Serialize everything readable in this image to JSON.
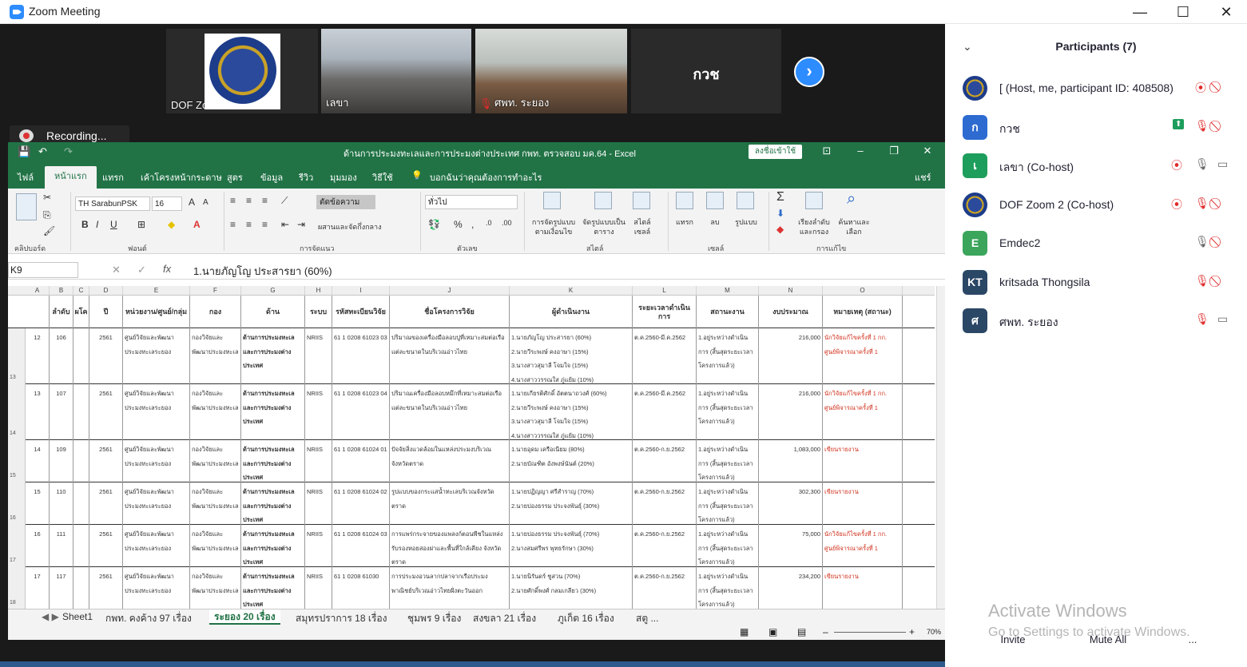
{
  "window": {
    "title": "Zoom Meeting",
    "min": "—",
    "max": "☐",
    "close": "✕"
  },
  "gallery": {
    "tiles": [
      {
        "name": "DOF Zoom 2"
      },
      {
        "name": "เลขา"
      },
      {
        "name": "ศพท. ระยอง"
      },
      {
        "name": "กวช"
      }
    ],
    "next": "›",
    "recording": "Recording..."
  },
  "excel": {
    "title": "ด้านการประมงทะเลและการประมงต่างประเทศ กพท. ตรวจสอบ มค.64  -  Excel",
    "signin": "ลงชื่อเข้าใช้",
    "tabs": [
      "ไฟล์",
      "หน้าแรก",
      "แทรก",
      "เค้าโครงหน้ากระดาษ",
      "สูตร",
      "ข้อมูล",
      "รีวิว",
      "มุมมอง",
      "วิธีใช้"
    ],
    "tellme": "บอกฉันว่าคุณต้องการทำอะไร",
    "share": "แชร์",
    "ribbon": {
      "font": "TH SarabunPSK",
      "size": "16",
      "wrap": "ตัดข้อความ",
      "merge": "ผสานและจัดกึ่งกลาง",
      "numfmt": "ทั่วไป",
      "groups": [
        "คลิปบอร์ด",
        "ฟอนต์",
        "การจัดแนว",
        "ตัวเลข",
        "สไตล์",
        "เซลล์",
        "การแก้ไข"
      ],
      "cond": "การจัดรูปแบบตามเงื่อนไข",
      "astable": "จัดรูปแบบเป็นตาราง",
      "cellstyle": "สไตล์เซลล์",
      "insert": "แทรก",
      "delete": "ลบ",
      "format": "รูปแบบ",
      "sort": "เรียงลำดับและกรอง",
      "find": "ค้นหาและเลือก"
    },
    "namebox": "K9",
    "formula": "1.นายภัญโญ  ประสารยา (60%)",
    "columns": [
      "A",
      "B",
      "C",
      "D",
      "E",
      "F",
      "G",
      "H",
      "I",
      "J",
      "K",
      "L",
      "M",
      "N",
      "O"
    ],
    "headers": [
      "",
      "ลำดับ",
      "ผโค",
      "ปี",
      "หน่วยงาน/ศูนย์/กลุ่ม",
      "กอง",
      "ด้าน",
      "ระบบ",
      "รหัสทะเบียนวิจัย",
      "ชื่อโครงการวิจัย",
      "ผู้ดำเนินงาน",
      "ระยะเวลาดำเนินการ",
      "สถานะงาน",
      "งบประมาณ",
      "หมายเหตุ (สถานะ)"
    ],
    "rows": [
      {
        "rn": "13",
        "a": "12",
        "b": "106",
        "d": "2561",
        "e": "ศูนย์วิจัยและพัฒนาประมงทะเลระยอง",
        "f": "กองวิจัยและพัฒนาประมงทะเล",
        "g": "ด้านการประมงทะเลและการประมงต่างประเทศ",
        "h": "NRIIS",
        "i": "61 1 0208 61023 03",
        "j": "ปริมาณของเครื่องมือลอบปูที่เหมาะสมต่อเรือแต่ละขนาดในบริเวณอ่าวไทย",
        "k": "1.นายภัญโญ ประสารยา (60%)\n2.นายวีระพงษ์ คงอาษา (15%)\n3.นางสาวสุมาลี โจมใจ (15%)\n4.นางสาววรรณใส ภู่แย้ม (10%)",
        "l": "ต.ค.2560-มี.ค.2562",
        "m": "1.อยู่ระหว่างดำเนินการ (สิ้นสุดระยะเวลาโครงการแล้ว)",
        "n": "216,000",
        "o": "นักวิจัยแก้ไขครั้งที่ 1 กก.\nศูนย์พิจารณาครั้งที่ 1",
        "ored": true
      },
      {
        "rn": "14",
        "a": "13",
        "b": "107",
        "d": "2561",
        "e": "ศูนย์วิจัยและพัฒนาประมงทะเลระยอง",
        "f": "กองวิจัยและพัฒนาประมงทะเล",
        "g": "ด้านการประมงทะเลและการประมงต่างประเทศ",
        "h": "NRIIS",
        "i": "61 1 0208 61023 04",
        "j": "ปริมาณเครื่องมือลอบหมึกที่เหมาะสมต่อเรือแต่ละขนาดในบริเวณอ่าวไทย",
        "k": "1.นายเกียรติศักดิ์ อัตตนาถวงศ์ (60%)\n2.นายวีระพงษ์ คงอาษา (15%)\n3.นางสาวสุมาลี โจมใจ (15%)\n4.นางสาววรรณใส ภู่แย้ม (10%)",
        "l": "ต.ค.2560-มี.ค.2562",
        "m": "1.อยู่ระหว่างดำเนินการ (สิ้นสุดระยะเวลาโครงการแล้ว)",
        "n": "216,000",
        "o": "นักวิจัยแก้ไขครั้งที่ 1 กก.\nศูนย์พิจารณาครั้งที่ 1",
        "ored": true
      },
      {
        "rn": "15",
        "a": "14",
        "b": "109",
        "d": "2561",
        "e": "ศูนย์วิจัยและพัฒนาประมงทะเลระยอง",
        "f": "กองวิจัยและพัฒนาประมงทะเล",
        "g": "ด้านการประมงทะเลและการประมงต่างประเทศ",
        "h": "NRIIS",
        "i": "61 1 0208 61024 01",
        "j": "ปัจจัยสิ่งแวดล้อมในแหล่งประมงบริเวณจังหวัดตราด",
        "k": "1.นายอุดม เครือเนียม (80%)\n2.นายบัณฑิต อังพงษ์นันต์ (20%)",
        "l": "ต.ค.2560-ก.ย.2562",
        "m": "1.อยู่ระหว่างดำเนินการ (สิ้นสุดระยะเวลาโครงการแล้ว)",
        "n": "1,083,000",
        "o": "เขียนรายงาน",
        "ored": true
      },
      {
        "rn": "16",
        "a": "15",
        "b": "110",
        "d": "2561",
        "e": "ศูนย์วิจัยและพัฒนาประมงทะเลระยอง",
        "f": "กองวิจัยและพัฒนาประมงทะเล",
        "g": "ด้านการประมงทะเลและการประมงต่างประเทศ",
        "h": "NRIIS",
        "i": "61 1 0208 61024 02",
        "j": "รูปแบบของกระแสน้ำทะเลบริเวณจังหวัดตราด",
        "k": "1.นายปฏิญญา ศรีสำราญ (70%)\n2.นายปองธรรม ประจงพันธุ์ (30%)",
        "l": "ต.ค.2560-ก.ย.2562",
        "m": "1.อยู่ระหว่างดำเนินการ (สิ้นสุดระยะเวลาโครงการแล้ว)",
        "n": "302,300",
        "o": "เขียนรายงาน",
        "ored": true
      },
      {
        "rn": "17",
        "a": "16",
        "b": "111",
        "d": "2561",
        "e": "ศูนย์วิจัยและพัฒนาประมงทะเลระยอง",
        "f": "กองวิจัยและพัฒนาประมงทะเล",
        "g": "ด้านการประมงทะเลและการประมงต่างประเทศ",
        "h": "NRIIS",
        "i": "61 1 0208 61024 03",
        "j": "การแพร่กระจายของแพลงก์ตอนพืชในแหล่งรับรองหอยสองฝาและพื้นที่ใกล้เคียง จังหวัดตราด",
        "k": "1.นายปองธรรม ประจงพันธุ์ (70%)\n2.นางสมศรีพร พุทธรักษา (30%)",
        "l": "ต.ค.2560-ก.ย.2562",
        "m": "1.อยู่ระหว่างดำเนินการ (สิ้นสุดระยะเวลาโครงการแล้ว)",
        "n": "75,000",
        "o": "นักวิจัยแก้ไขครั้งที่ 1 กก.\nศูนย์พิจารณาครั้งที่ 1",
        "ored": true
      },
      {
        "rn": "18",
        "a": "17",
        "b": "117",
        "d": "2561",
        "e": "ศูนย์วิจัยและพัฒนาประมงทะเลระยอง",
        "f": "กองวิจัยและพัฒนาประมงทะเล",
        "g": "ด้านการประมงทะเลและการประมงต่างประเทศ",
        "h": "NRIIS",
        "i": "61 1 0208 61030",
        "j": "การประมงอวนลากปลาจากเรือประมงพาณิชย์บริเวณอ่าวไทยฝั่งตะวันออก",
        "k": "1.นายนิรันดร์ ชูสวน (70%)\n2.นายศักดิ์พงศ์ กลมเกลียว (30%)",
        "l": "ต.ค.2560-ก.ย.2562",
        "m": "1.อยู่ระหว่างดำเนินการ (สิ้นสุดระยะเวลาโครงการแล้ว)",
        "n": "234,200",
        "o": "เขียนรายงาน",
        "ored": true
      }
    ],
    "sheets": [
      "Sheet1",
      "กพท. คงค้าง 97 เรื่อง",
      "ระยอง 20 เรื่อง",
      "สมุทรปราการ 18 เรื่อง",
      "ชุมพร 9 เรื่อง",
      "สงขลา 21 เรื่อง",
      "ภูเก็ต 16 เรื่อง",
      "สตู ..."
    ],
    "zoom": "70%"
  },
  "participants": {
    "title": "Participants (7)",
    "list": [
      {
        "name": "[ (Host, me, participant ID: 408508)",
        "initial": "",
        "color": "#1d3c8a",
        "emblem": true
      },
      {
        "name": "กวช",
        "initial": "ก",
        "color": "#2d6bd1"
      },
      {
        "name": "เลขา (Co-host)",
        "initial": "เ",
        "color": "#1e9e5c"
      },
      {
        "name": "DOF Zoom 2 (Co-host)",
        "initial": "",
        "color": "#1d3c8a",
        "emblem": true
      },
      {
        "name": "Emdec2",
        "initial": "E",
        "color": "#3ba55c"
      },
      {
        "name": "kritsada Thongsila",
        "initial": "KT",
        "color": "#2b4766"
      },
      {
        "name": "ศพท. ระยอง",
        "initial": "ศ",
        "color": "#2b4766"
      }
    ],
    "invite": "Invite",
    "muteall": "Mute All",
    "more": "..."
  },
  "watermark": {
    "title": "Activate Windows",
    "sub": "Go to Settings to activate Windows."
  }
}
